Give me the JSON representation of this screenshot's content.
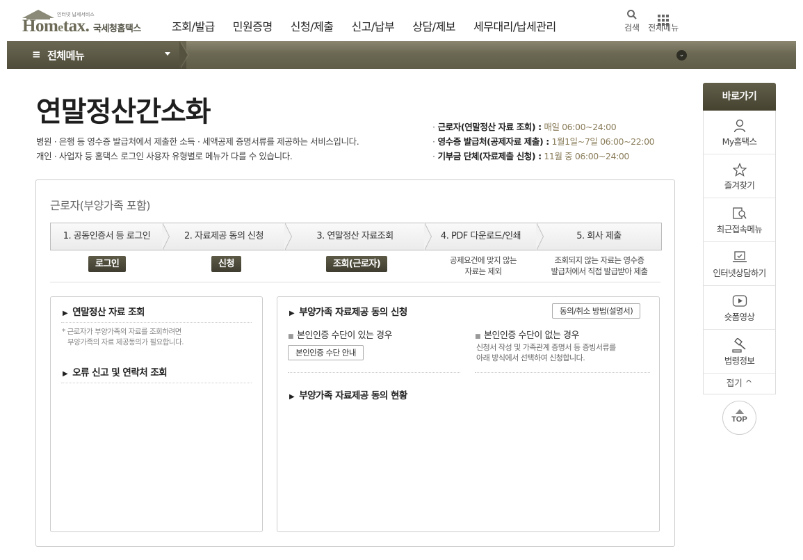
{
  "header": {
    "logo_small": "인터넷 납세서비스",
    "logo_brand_a": "Hom",
    "logo_brand_e": "e",
    "logo_brand_b": "tax.",
    "logo_korean": "국세청홈택스",
    "nav": [
      "조회/발급",
      "민원증명",
      "신청/제출",
      "신고/납부",
      "상담/제보",
      "세무대리/납세관리"
    ],
    "search_label": "검색",
    "allmenu_label": "전체메뉴"
  },
  "menubar": {
    "icon": "≡",
    "label": "전체메뉴"
  },
  "page": {
    "title": "연말정산간소화",
    "desc_line1": "병원 · 은행 등 영수증 발급처에서 제출한 소득 · 세액공제 증명서류를 제공하는 서비스입니다.",
    "desc_line2": "개인 · 사업자 등 홈택스 로그인 사용자 유형별로 메뉴가 다를 수 있습니다.",
    "hours": [
      {
        "who": "근로자(연말정산 자료 조회) :",
        "pre": "매일",
        "time": "06:00~24:00"
      },
      {
        "who": "영수증 발급처(공제자료 제출) :",
        "pre": "1월1일~7일",
        "time": "06:00~22:00"
      },
      {
        "who": "기부금 단체(자료제출 신청) :",
        "pre": "11월 중",
        "time": "06:00~24:00"
      }
    ]
  },
  "main": {
    "subtitle": "근로자(부양가족 포함)",
    "steps": [
      "1. 공동인증서 등 로그인",
      "2. 자료제공 동의 신청",
      "3. 연말정산 자료조회",
      "4. PDF 다운로드/인쇄",
      "5. 회사 제출"
    ],
    "step_actions": {
      "login": "로그인",
      "apply": "신청",
      "view": "조회(근로자)",
      "note4_l1": "공제요건에 맞지 않는",
      "note4_l2": "자료는 제외",
      "note5_l1": "조회되지 않는 자료는 영수증",
      "note5_l2": "발급처에서 직접 발급받아 제출"
    },
    "left_panel": {
      "head1": "연말정산 자료 조회",
      "note_l1": "* 근로자가 부양가족의 자료를 조회하려면",
      "note_l2": "부양가족의 자료 제공동의가 필요합니다.",
      "head2": "오류 신고 및 연락처 조회"
    },
    "right_panel": {
      "head1": "부양가족 자료제공 동의 신청",
      "guide_button": "동의/취소 방법(설명서)",
      "with_cert": "본인인증 수단이 있는 경우",
      "cert_button": "본인인증 수단 안내",
      "without_cert": "본인인증 수단이 없는 경우",
      "without_note_l1": "신청서 작성 및 가족관계 증명서 등 증빙서류를",
      "without_note_l2": "아래 방식에서 선택하여 신청합니다.",
      "head2": "부양가족 자료제공 동의 현황"
    }
  },
  "quick": {
    "title": "바로가기",
    "items": [
      "My홈택스",
      "즐겨찾기",
      "최근접속메뉴",
      "인터넷상담하기",
      "숏폼영상",
      "법령정보"
    ],
    "fold": "접기 ^",
    "top": "TOP"
  }
}
